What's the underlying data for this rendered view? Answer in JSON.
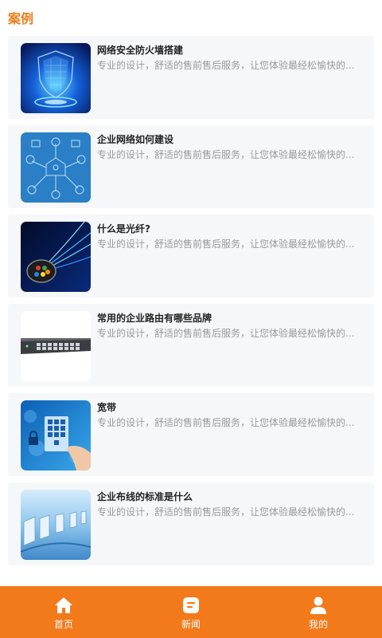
{
  "section_title": "案例",
  "cases": [
    {
      "title": "网络安全防火墙搭建",
      "desc": "专业的设计，舒适的售前售后服务，让您体验最经松愉快的...",
      "image": "firewall-shield-image"
    },
    {
      "title": "企业网络如何建设",
      "desc": "专业的设计，舒适的售前售后服务，让您体验最经松愉快的...",
      "image": "network-icons-image"
    },
    {
      "title": "什么是光纤?",
      "desc": "专业的设计，舒适的售前售后服务，让您体验最经松愉快的...",
      "image": "fiber-optic-image"
    },
    {
      "title": "常用的企业路由有哪些品牌",
      "desc": "专业的设计，舒适的售前售后服务，让您体验最经松愉快的...",
      "image": "router-switch-image"
    },
    {
      "title": "宽带",
      "desc": "专业的设计，舒适的售前售后服务，让您体验最经松愉快的...",
      "image": "keypad-map-image"
    },
    {
      "title": "企业布线的标准是什么",
      "desc": "专业的设计，舒适的售前售后服务，让您体验最经松愉快的...",
      "image": "cabling-server-image"
    }
  ],
  "tabbar": {
    "items": [
      {
        "label": "首页",
        "icon": "home-icon"
      },
      {
        "label": "新闻",
        "icon": "news-icon"
      },
      {
        "label": "我的",
        "icon": "user-icon"
      }
    ]
  },
  "colors": {
    "accent": "#f37a1a",
    "title": "#f07a16",
    "card_bg": "#f6f7f9"
  }
}
